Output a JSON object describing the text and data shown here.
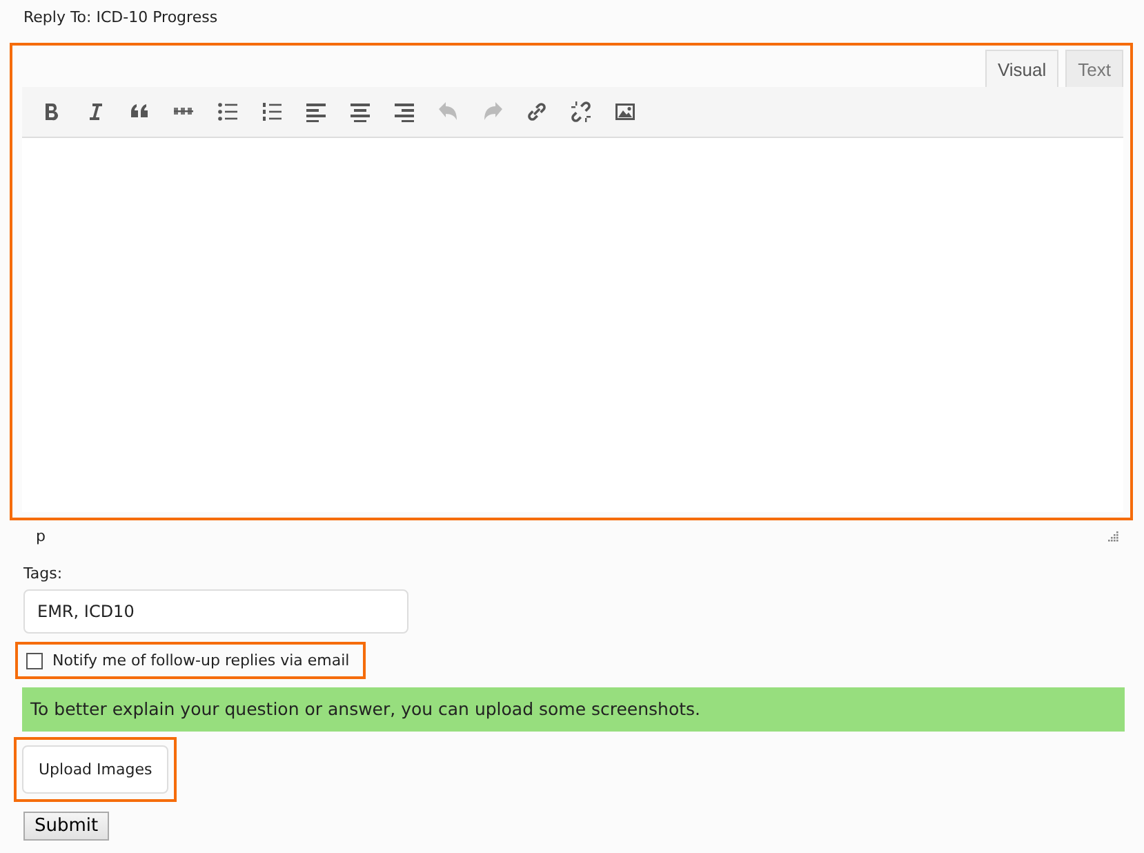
{
  "reply_to": "Reply To: ICD-10 Progress",
  "editor": {
    "highlighted": true,
    "tabs": [
      {
        "label": "Visual",
        "selected": true
      },
      {
        "label": "Text",
        "selected": false
      }
    ],
    "toolbar": [
      {
        "kind": "bold",
        "disabled": false
      },
      {
        "kind": "italic",
        "disabled": false
      },
      {
        "kind": "quote",
        "disabled": false
      },
      {
        "kind": "strike",
        "disabled": false
      },
      {
        "kind": "bullets",
        "disabled": false
      },
      {
        "kind": "numbers",
        "disabled": false
      },
      {
        "kind": "align-left",
        "disabled": false
      },
      {
        "kind": "align-center",
        "disabled": false
      },
      {
        "kind": "align-right",
        "disabled": false
      },
      {
        "kind": "undo",
        "disabled": true
      },
      {
        "kind": "redo",
        "disabled": true
      },
      {
        "kind": "link",
        "disabled": false
      },
      {
        "kind": "unlink",
        "disabled": false
      },
      {
        "kind": "image",
        "disabled": false
      }
    ],
    "path": "p"
  },
  "tags": {
    "label": "Tags:",
    "value": "EMR, ICD10"
  },
  "notify": {
    "label": "Notify me of follow-up replies via email",
    "checked": false,
    "highlighted": true
  },
  "notice": "To better explain your question or answer, you can upload some screenshots.",
  "upload": {
    "label": "Upload Images",
    "highlighted": true
  },
  "submit": "Submit"
}
